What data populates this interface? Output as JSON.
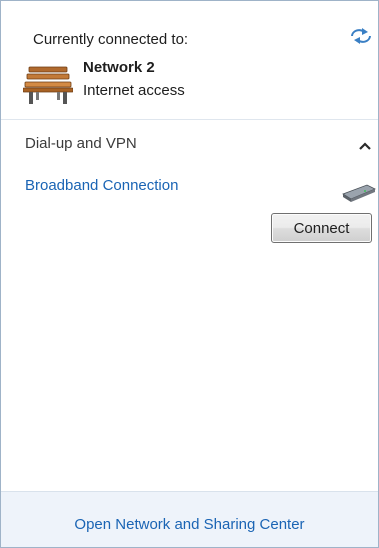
{
  "current": {
    "label": "Currently connected to:",
    "network_name": "Network  2",
    "network_status": "Internet access"
  },
  "vpn_section": {
    "title": "Dial-up and VPN",
    "connections": [
      {
        "name": "Broadband Connection",
        "button_label": "Connect"
      }
    ]
  },
  "footer": {
    "link_text": "Open Network and Sharing Center"
  },
  "icons": {
    "refresh": "refresh-icon",
    "network": "bench-network-icon",
    "collapse": "chevron-up-icon",
    "modem": "modem-icon"
  },
  "colors": {
    "link": "#1a64b4",
    "footer_bg": "#eef3fa",
    "border": "#9fb3c8"
  }
}
